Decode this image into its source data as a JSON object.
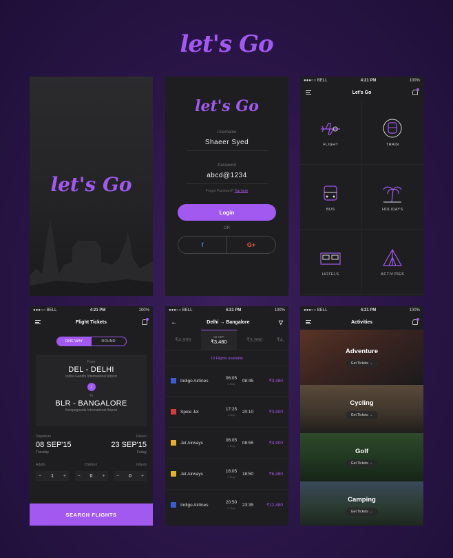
{
  "brand": "let's Go",
  "colors": {
    "accent": "#a259f0",
    "panel": "#1e1e20"
  },
  "status": {
    "carrier": "●●●○○ BELL",
    "time": "4:21 PM",
    "battery": "100%"
  },
  "splash": {
    "logo": "let's Go"
  },
  "login": {
    "logo": "let's Go",
    "username_label": "Username",
    "username_value": "Shaeer Syed",
    "password_label": "Password",
    "password_value": "abcd@1234",
    "forgot_text": "Forgot Password?",
    "forgot_link": "Tap here",
    "login_button": "Login",
    "or": "OR",
    "facebook_icon": "f",
    "google_icon": "G+"
  },
  "home": {
    "title": "Let's Go",
    "categories": [
      {
        "label": "FLIGHT",
        "icon": "plane-icon"
      },
      {
        "label": "TRAIN",
        "icon": "train-icon"
      },
      {
        "label": "BUS",
        "icon": "bus-icon"
      },
      {
        "label": "HOLIDAYS",
        "icon": "palm-icon"
      },
      {
        "label": "HOTELS",
        "icon": "bed-icon"
      },
      {
        "label": "ACTIVITIES",
        "icon": "tent-icon"
      }
    ]
  },
  "tickets": {
    "title": "Flight Tickets",
    "one_way": "ONE WAY",
    "round": "ROUND",
    "from_label": "From",
    "from_city": "DEL - DELHI",
    "from_airport": "Indira Gandhi International Airport",
    "to_label": "To",
    "to_city": "BLR - BANGALORE",
    "to_airport": "Kempegowda International Airport",
    "departure_label": "Departure",
    "departure_date": "08 SEP'15",
    "departure_day": "Tuesday",
    "return_label": "Return",
    "return_date": "23 SEP'15",
    "return_day": "Friday",
    "adults_label": "Adults",
    "children_label": "Children",
    "infants_label": "Infants",
    "adults": "1",
    "children": "0",
    "infants": "0",
    "search_button": "SEARCH FLIGHTS"
  },
  "results": {
    "title_from": "Delhi",
    "title_arrow": "→",
    "title_to": "Bangalore",
    "dates": [
      {
        "date": "",
        "price": "₹4,999"
      },
      {
        "date": "08 SEP",
        "price": "₹3,480"
      },
      {
        "date": "",
        "price": "₹3,990"
      },
      {
        "date": "",
        "price": "₹4,"
      }
    ],
    "available": "19 Flights available",
    "flights": [
      {
        "airline": "Indigo Airlines",
        "dep": "06:05",
        "arr": "08:45",
        "stops": "1 Stop",
        "price": "₹3,480",
        "color": "#3a5bd9"
      },
      {
        "airline": "Spice Jet",
        "dep": "17:25",
        "arr": "20:10",
        "stops": "1 Stop",
        "price": "₹3,900",
        "color": "#d93a3a"
      },
      {
        "airline": "Jet Airways",
        "dep": "06:05",
        "arr": "08:55",
        "stops": "1 Stop",
        "price": "₹4,900",
        "color": "#e8b02a"
      },
      {
        "airline": "Jet Airways",
        "dep": "16:05",
        "arr": "18:50",
        "stops": "2 Stop",
        "price": "₹6,480",
        "color": "#e8b02a"
      },
      {
        "airline": "Indigo Airlines",
        "dep": "20:50",
        "arr": "23:35",
        "stops": "2 Stop",
        "price": "₹12,480",
        "color": "#3a5bd9"
      }
    ]
  },
  "activities": {
    "title": "Activities",
    "get_tickets": "Get Tickets  →",
    "items": [
      "Adventure",
      "Cycling",
      "Golf",
      "Camping"
    ]
  }
}
